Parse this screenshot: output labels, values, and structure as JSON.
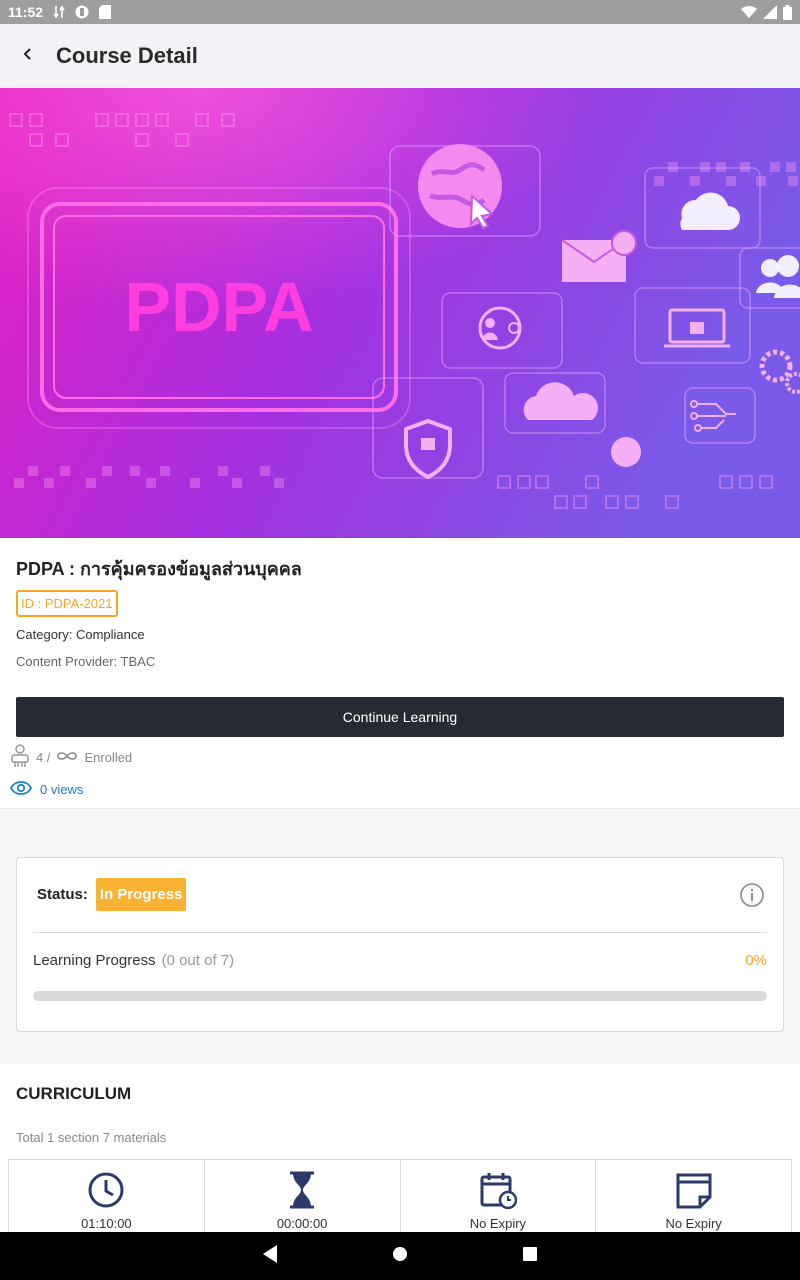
{
  "status_bar": {
    "time": "11:52",
    "icons": [
      "data-transfer-icon",
      "app-notification-icon",
      "sd-card-icon",
      "wifi-icon",
      "signal-icon",
      "battery-icon"
    ]
  },
  "app_bar": {
    "title": "Course Detail",
    "back_icon": "chevron-left-icon"
  },
  "banner": {
    "text": "PDPA",
    "colors": {
      "start": "#e61fbf",
      "end": "#7a3de8"
    }
  },
  "course": {
    "title": "PDPA : การคุ้มครองข้อมูลส่วนบุคคล",
    "id_label": "ID : PDPA-2021",
    "category": "Category: Compliance",
    "provider": "Content Provider: TBAC"
  },
  "actions": {
    "continue_label": "Continue Learning"
  },
  "enrollment": {
    "count": "4 /",
    "limit_icon": "infinity-icon",
    "label": "Enrolled"
  },
  "views": {
    "label": "0 views"
  },
  "status_card": {
    "status_label": "Status:",
    "status_value": "In Progress",
    "progress_label": "Learning Progress",
    "progress_count": "(0 out of 7)",
    "progress_percent": "0%",
    "progress_fraction": 0
  },
  "curriculum": {
    "title": "CURRICULUM",
    "summary": "Total 1 section 7 materials"
  },
  "stats": [
    {
      "icon": "clock-icon",
      "value": "01:10:00"
    },
    {
      "icon": "hourglass-icon",
      "value": "00:00:00"
    },
    {
      "icon": "calendar-clock-icon",
      "value": "No Expiry"
    },
    {
      "icon": "note-icon",
      "value": "No Expiry"
    }
  ],
  "colors": {
    "accent": "#f5a623",
    "button_dark": "#262b33",
    "link_blue": "#1a7fc4",
    "icon_navy": "#2b3a6b"
  }
}
